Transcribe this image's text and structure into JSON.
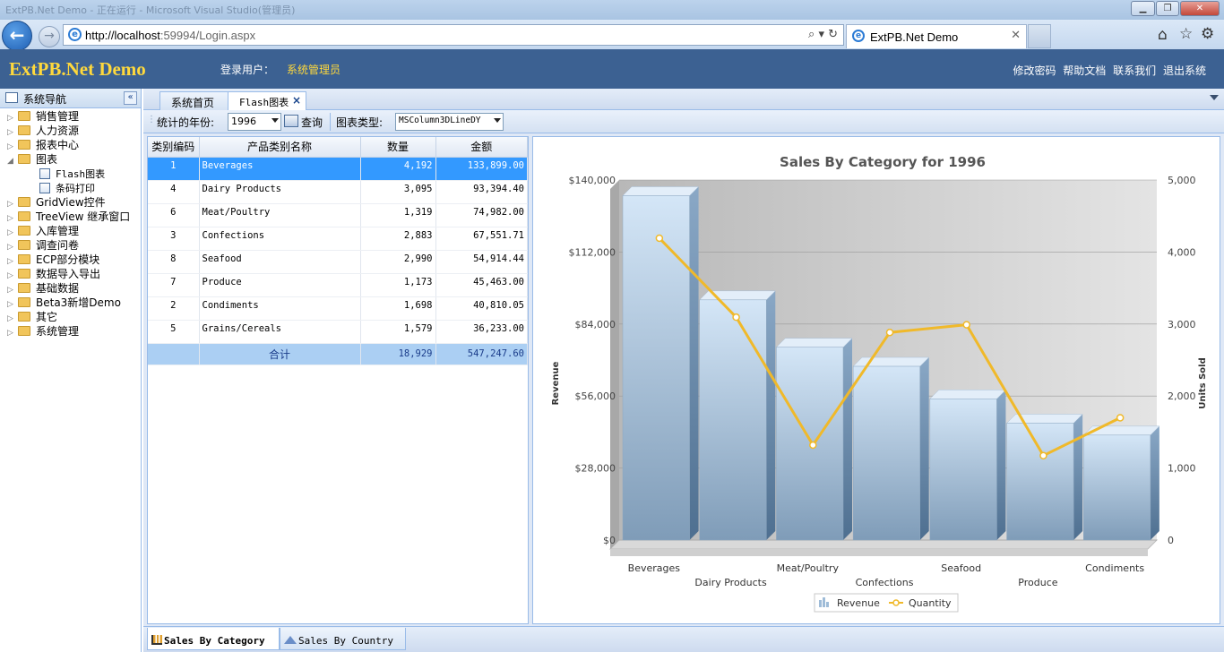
{
  "window": {
    "title_faded": "ExtPB.Net Demo - 正在运行 - Microsoft Visual Studio(管理员)"
  },
  "browser": {
    "url_host": "http://localhost",
    "url_rest": ":59994/Login.aspx",
    "tab_title": "ExtPB.Net Demo",
    "search_symbol": "⌕ ▾ ↻"
  },
  "header": {
    "logo": "ExtPB.Net Demo",
    "user_label": "登录用户：",
    "user_name": "系统管理员",
    "links": [
      "修改密码",
      "帮助文档",
      "联系我们",
      "退出系统"
    ]
  },
  "sidebar": {
    "title": "系统导航",
    "items": [
      {
        "label": "销售管理",
        "type": "folder",
        "expanded": false
      },
      {
        "label": "人力资源",
        "type": "folder",
        "expanded": false
      },
      {
        "label": "报表中心",
        "type": "folder",
        "expanded": false
      },
      {
        "label": "图表",
        "type": "folder",
        "expanded": true
      },
      {
        "label": "Flash图表",
        "type": "doc"
      },
      {
        "label": "条码打印",
        "type": "doc"
      },
      {
        "label": "GridView控件",
        "type": "folder",
        "expanded": false
      },
      {
        "label": "TreeView 继承窗口",
        "type": "folder",
        "expanded": false
      },
      {
        "label": "入库管理",
        "type": "folder",
        "expanded": false
      },
      {
        "label": "调查问卷",
        "type": "folder",
        "expanded": false
      },
      {
        "label": "ECP部分模块",
        "type": "folder",
        "expanded": false
      },
      {
        "label": "数据导入导出",
        "type": "folder",
        "expanded": false
      },
      {
        "label": "基础数据",
        "type": "folder",
        "expanded": false
      },
      {
        "label": "Beta3新增Demo",
        "type": "folder",
        "expanded": false
      },
      {
        "label": "其它",
        "type": "folder",
        "expanded": false
      },
      {
        "label": "系统管理",
        "type": "folder",
        "expanded": false
      }
    ]
  },
  "tabs": [
    {
      "label": "系统首页",
      "active": false
    },
    {
      "label": "Flash图表",
      "active": true,
      "close": "×"
    }
  ],
  "toolbar": {
    "year_label": "统计的年份:",
    "year_value": "1996",
    "query_label": "查询",
    "type_label": "图表类型:",
    "type_value": "MSColumn3DLineDY"
  },
  "grid": {
    "columns": [
      "类别编码",
      "产品类别名称",
      "数量",
      "金额"
    ],
    "rows": [
      {
        "id": "1",
        "name": "Beverages",
        "qty": "4,192",
        "amount": "133,899.00"
      },
      {
        "id": "4",
        "name": "Dairy Products",
        "qty": "3,095",
        "amount": "93,394.40"
      },
      {
        "id": "6",
        "name": "Meat/Poultry",
        "qty": "1,319",
        "amount": "74,982.00"
      },
      {
        "id": "3",
        "name": "Confections",
        "qty": "2,883",
        "amount": "67,551.71"
      },
      {
        "id": "8",
        "name": "Seafood",
        "qty": "2,990",
        "amount": "54,914.44"
      },
      {
        "id": "7",
        "name": "Produce",
        "qty": "1,173",
        "amount": "45,463.00"
      },
      {
        "id": "2",
        "name": "Condiments",
        "qty": "1,698",
        "amount": "40,810.05"
      },
      {
        "id": "5",
        "name": "Grains/Cereals",
        "qty": "1,579",
        "amount": "36,233.00"
      }
    ],
    "total": {
      "label": "合计",
      "qty": "18,929",
      "amount": "547,247.60"
    }
  },
  "chart_data": {
    "type": "bar",
    "title": "Sales By Category for 1996",
    "ylabel": "Revenue",
    "y2label": "Units Sold",
    "categories": [
      "Beverages",
      "Dairy Products",
      "Meat/Poultry",
      "Confections",
      "Seafood",
      "Produce",
      "Condiments"
    ],
    "series": [
      {
        "name": "Revenue",
        "type": "bar",
        "axis": "left",
        "values": [
          133899,
          93394,
          74982,
          67552,
          54914,
          45463,
          40810
        ]
      },
      {
        "name": "Quantity",
        "type": "line",
        "axis": "right",
        "values": [
          4192,
          3095,
          1319,
          2883,
          2990,
          1173,
          1698
        ]
      }
    ],
    "ylim": [
      0,
      140000
    ],
    "y2lim": [
      0,
      5000
    ],
    "yticks": [
      "$0",
      "$28,000",
      "$56,000",
      "$84,000",
      "$112,000",
      "$140,000"
    ],
    "y2ticks": [
      "0",
      "1,000",
      "2,000",
      "3,000",
      "4,000",
      "5,000"
    ],
    "legend_position": "bottom",
    "colors": {
      "bar": "#a9c8e8",
      "line": "#f0b92a",
      "plot_bg": "#c9c9c9"
    }
  },
  "bottom_tabs": [
    {
      "label": "Sales By Category",
      "active": true
    },
    {
      "label": "Sales By Country",
      "active": false
    }
  ]
}
